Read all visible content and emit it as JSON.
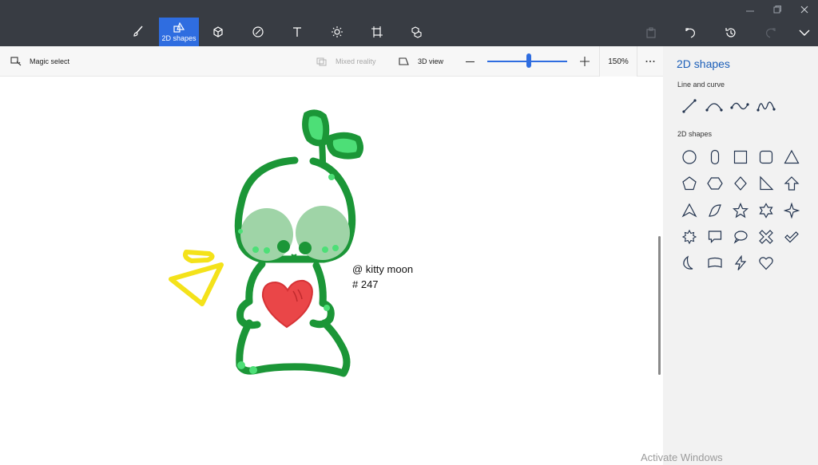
{
  "toolbar": {
    "tools": [
      {
        "name": "brushes",
        "icon": "brush-icon",
        "label": ""
      },
      {
        "name": "2d-shapes",
        "icon": "2d-shapes-icon",
        "label": "2D shapes",
        "active": true
      },
      {
        "name": "3d-shapes",
        "icon": "cube-icon",
        "label": ""
      },
      {
        "name": "stickers",
        "icon": "sticker-icon",
        "label": ""
      },
      {
        "name": "text",
        "icon": "text-icon",
        "label": ""
      },
      {
        "name": "effects",
        "icon": "sun-icon",
        "label": ""
      },
      {
        "name": "canvas",
        "icon": "crop-icon",
        "label": ""
      },
      {
        "name": "3d-library",
        "icon": "3d-library-icon",
        "label": ""
      }
    ],
    "accent_color": "#2f6de0",
    "bar_color": "#383c43"
  },
  "commandbar": {
    "magic_select": "Magic select",
    "mixed_reality": "Mixed reality",
    "view_3d": "3D view",
    "zoom": "150%",
    "zoom_level": 0.5
  },
  "canvas": {
    "caption_line1": "@ kitty moon",
    "caption_line2": "# 247"
  },
  "panel": {
    "title": "2D shapes",
    "line_section": "Line and curve",
    "shapes_section": "2D shapes",
    "line_tools": [
      "line-icon",
      "curve-icon",
      "s-curve-icon",
      "wave-curve-icon"
    ],
    "shape_tools": [
      "circle-icon",
      "capsule-icon",
      "square-icon",
      "rounded-square-icon",
      "triangle-icon",
      "pentagon-icon",
      "hexagon-icon",
      "diamond-icon",
      "right-triangle-icon",
      "arrow-up-icon",
      "arrowhead-icon",
      "quarter-shape-icon",
      "star-5-icon",
      "star-6-icon",
      "star-4-icon",
      "burst-icon",
      "speech-bubble-icon",
      "thought-bubble-icon",
      "cross-icon",
      "checkmark-icon",
      "crescent-icon",
      "banner-icon",
      "lightning-icon",
      "heart-icon"
    ]
  },
  "watermark": "Activate Windows"
}
